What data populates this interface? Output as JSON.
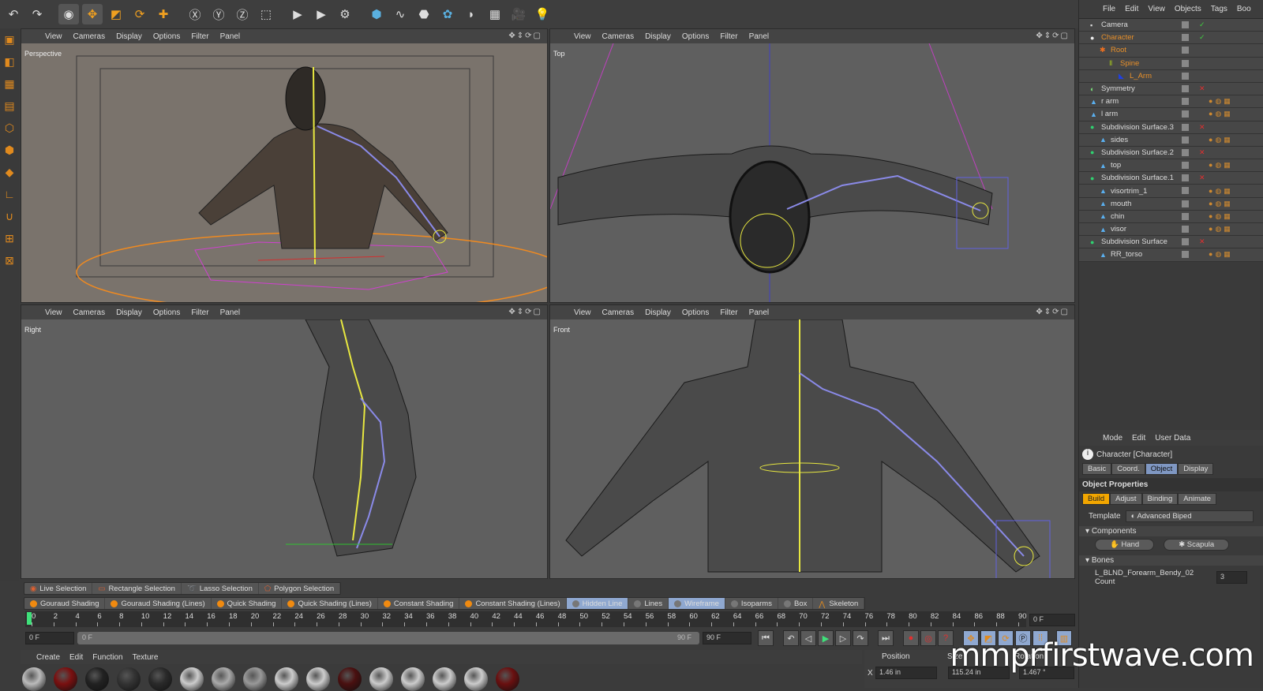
{
  "toolbar": {
    "icons": [
      "undo-icon",
      "redo-icon",
      "live-selection-icon",
      "move-icon",
      "scale-icon",
      "rotate-icon",
      "add-icon",
      "x-axis-icon",
      "y-axis-icon",
      "z-axis-icon",
      "coordinate-system-icon",
      "render-view-icon",
      "render-picture-viewer-icon",
      "render-settings-icon",
      "cube-icon",
      "spline-icon",
      "nurbs-icon",
      "array-icon",
      "deformer-icon",
      "floor-icon",
      "camera-icon",
      "light-icon"
    ]
  },
  "viewports": [
    {
      "name": "Perspective",
      "menu": [
        "View",
        "Cameras",
        "Display",
        "Options",
        "Filter",
        "Panel"
      ]
    },
    {
      "name": "Top",
      "menu": [
        "View",
        "Cameras",
        "Display",
        "Options",
        "Filter",
        "Panel"
      ]
    },
    {
      "name": "Right",
      "menu": [
        "View",
        "Cameras",
        "Display",
        "Options",
        "Filter",
        "Panel"
      ]
    },
    {
      "name": "Front",
      "menu": [
        "View",
        "Cameras",
        "Display",
        "Options",
        "Filter",
        "Panel"
      ]
    }
  ],
  "object_manager": {
    "menu": [
      "File",
      "Edit",
      "View",
      "Objects",
      "Tags",
      "Boo"
    ],
    "objects": [
      {
        "name": "Camera",
        "icon": "camera-icon",
        "level": 0,
        "highlight": false,
        "flag": "✓"
      },
      {
        "name": "Character",
        "icon": "character-icon",
        "level": 0,
        "highlight": true,
        "flag": "✓"
      },
      {
        "name": "Root",
        "icon": "root-icon",
        "level": 1,
        "highlight": true,
        "flag": ""
      },
      {
        "name": "Spine",
        "icon": "spine-icon",
        "level": 2,
        "highlight": true,
        "flag": ""
      },
      {
        "name": "L_Arm",
        "icon": "arm-icon",
        "level": 3,
        "highlight": true,
        "flag": ""
      },
      {
        "name": "Symmetry",
        "icon": "symmetry-icon",
        "level": 0,
        "highlight": false,
        "flag": "✕"
      },
      {
        "name": "r arm",
        "icon": "polygon-icon",
        "level": 0,
        "highlight": false,
        "flag": ""
      },
      {
        "name": "l arm",
        "icon": "polygon-icon",
        "level": 0,
        "highlight": false,
        "flag": ""
      },
      {
        "name": "Subdivision Surface.3",
        "icon": "subdivision-icon",
        "level": 0,
        "highlight": false,
        "flag": "✕"
      },
      {
        "name": "sides",
        "icon": "polygon-icon",
        "level": 1,
        "highlight": false,
        "flag": ""
      },
      {
        "name": "Subdivision Surface.2",
        "icon": "subdivision-icon",
        "level": 0,
        "highlight": false,
        "flag": "✕"
      },
      {
        "name": "top",
        "icon": "polygon-icon",
        "level": 1,
        "highlight": false,
        "flag": ""
      },
      {
        "name": "Subdivision Surface.1",
        "icon": "subdivision-icon",
        "level": 0,
        "highlight": false,
        "flag": "✕"
      },
      {
        "name": "visortrim_1",
        "icon": "polygon-icon",
        "level": 1,
        "highlight": false,
        "flag": ""
      },
      {
        "name": "mouth",
        "icon": "polygon-icon",
        "level": 1,
        "highlight": false,
        "flag": ""
      },
      {
        "name": "chin",
        "icon": "polygon-icon",
        "level": 1,
        "highlight": false,
        "flag": ""
      },
      {
        "name": "visor",
        "icon": "polygon-icon",
        "level": 1,
        "highlight": false,
        "flag": ""
      },
      {
        "name": "Subdivision Surface",
        "icon": "subdivision-icon",
        "level": 0,
        "highlight": false,
        "flag": "✕"
      },
      {
        "name": "RR_torso",
        "icon": "polygon-icon",
        "level": 1,
        "highlight": false,
        "flag": ""
      }
    ]
  },
  "attribute_manager": {
    "menu": [
      "Mode",
      "Edit",
      "User Data"
    ],
    "title": "Character [Character]",
    "tabs": [
      "Basic",
      "Coord.",
      "Object",
      "Display"
    ],
    "active_tab": "Object",
    "section": "Object Properties",
    "subtabs": [
      "Build",
      "Adjust",
      "Binding",
      "Animate"
    ],
    "template_label": "Template",
    "template_value": "Advanced Biped",
    "components_label": "Components",
    "components": [
      "Hand",
      "Scapula"
    ],
    "bones_label": "Bones",
    "bone_param_label": "L_BLND_Forearm_Bendy_02 Count",
    "bone_param_value": "3"
  },
  "selection_bar": [
    "Live Selection",
    "Rectangle Selection",
    "Lasso Selection",
    "Polygon Selection"
  ],
  "shading_bar": [
    {
      "label": "Gouraud Shading",
      "active": false
    },
    {
      "label": "Gouraud Shading (Lines)",
      "active": false
    },
    {
      "label": "Quick Shading",
      "active": false
    },
    {
      "label": "Quick Shading (Lines)",
      "active": false
    },
    {
      "label": "Constant Shading",
      "active": false
    },
    {
      "label": "Constant Shading (Lines)",
      "active": false
    },
    {
      "label": "Hidden Line",
      "active": true
    },
    {
      "label": "Lines",
      "active": false
    },
    {
      "label": "Wireframe",
      "active": true
    },
    {
      "label": "Isoparms",
      "active": false
    },
    {
      "label": "Box",
      "active": false
    },
    {
      "label": "Skeleton",
      "active": false
    }
  ],
  "timeline": {
    "ticks": [
      0,
      2,
      4,
      6,
      8,
      10,
      12,
      14,
      16,
      18,
      20,
      22,
      24,
      26,
      28,
      30,
      32,
      34,
      36,
      38,
      40,
      42,
      44,
      46,
      48,
      50,
      52,
      54,
      56,
      58,
      60,
      62,
      64,
      66,
      68,
      70,
      72,
      74,
      76,
      78,
      80,
      82,
      84,
      86,
      88,
      90
    ],
    "current_frame": "0 F",
    "start": "0 F",
    "range_start": "0 F",
    "range_end": "90 F",
    "end": "90 F",
    "min": 0,
    "max": 90
  },
  "material_manager": {
    "menu": [
      "Create",
      "Edit",
      "Function",
      "Texture"
    ]
  },
  "coordinates": {
    "position_label": "Position",
    "size_label": "Size",
    "rotation_label": "Rotation",
    "x_pos": "1.46 in",
    "x_size": "115.24 in",
    "x_rot": "1.467 °",
    "x_axis": "X"
  },
  "watermark": "mmprfirstwave.com"
}
